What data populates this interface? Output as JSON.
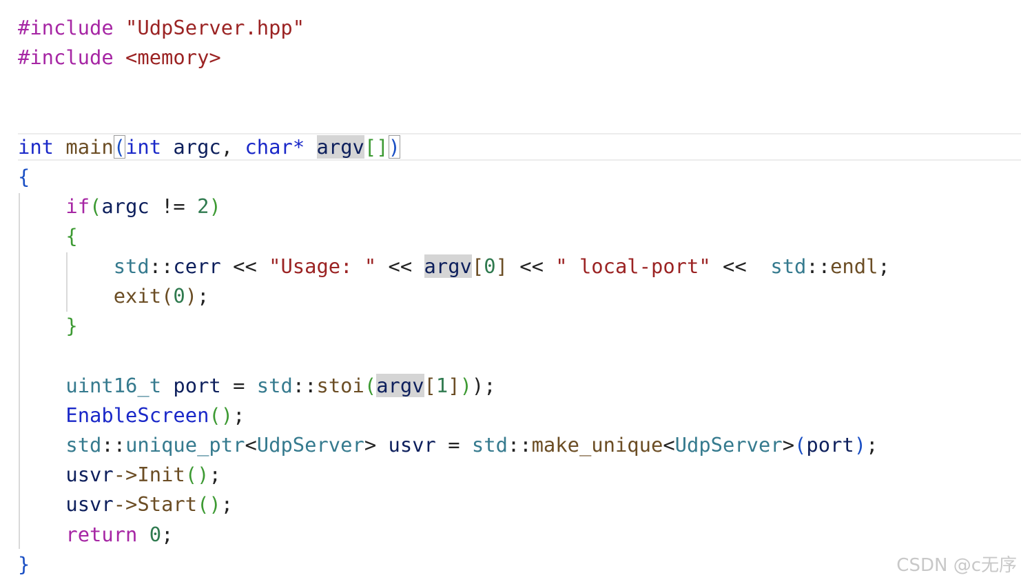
{
  "colors": {
    "directive": "#a626a4",
    "string": "#9b2323",
    "keyword": "#1a28c8",
    "type": "#357a8e",
    "function": "#6b4d24",
    "variable": "#0d1f5c",
    "number": "#2f7a4f",
    "plain": "#222222",
    "bracket_green": "#3d9a33",
    "bracket_blue": "#1a4fc4",
    "highlight_bg": "#d5d5d5",
    "match_border": "#9a9a9a",
    "watermark": "#c8c8c8"
  },
  "code": {
    "lines": [
      {
        "n": 1,
        "tokens": [
          {
            "t": "#include",
            "c": "directive"
          },
          {
            "t": " ",
            "c": "plain"
          },
          {
            "t": "\"UdpServer.hpp\"",
            "c": "string"
          }
        ]
      },
      {
        "n": 2,
        "tokens": [
          {
            "t": "#include",
            "c": "directive"
          },
          {
            "t": " ",
            "c": "plain"
          },
          {
            "t": "<memory>",
            "c": "string"
          }
        ]
      },
      {
        "n": 3,
        "tokens": []
      },
      {
        "n": 4,
        "tokens": []
      },
      {
        "n": 5,
        "tokens": [
          {
            "t": "int",
            "c": "keyword"
          },
          {
            "t": " ",
            "c": "plain"
          },
          {
            "t": "main",
            "c": "function"
          },
          {
            "t": "(",
            "c": "bracket_blue",
            "box": true
          },
          {
            "t": "int",
            "c": "keyword"
          },
          {
            "t": " ",
            "c": "plain"
          },
          {
            "t": "argc",
            "c": "variable"
          },
          {
            "t": ", ",
            "c": "plain"
          },
          {
            "t": "char",
            "c": "keyword"
          },
          {
            "t": "* ",
            "c": "keyword"
          },
          {
            "t": "argv",
            "c": "variable",
            "hl": true
          },
          {
            "t": "[]",
            "c": "bracket_green"
          },
          {
            "t": ")",
            "c": "bracket_blue",
            "box": true
          }
        ]
      },
      {
        "n": 6,
        "tokens": [
          {
            "t": "{",
            "c": "bracket_blue"
          }
        ]
      },
      {
        "n": 7,
        "tokens": [
          {
            "t": "    ",
            "c": "plain"
          },
          {
            "t": "if",
            "c": "directive"
          },
          {
            "t": "(",
            "c": "bracket_green"
          },
          {
            "t": "argc",
            "c": "variable"
          },
          {
            "t": " != ",
            "c": "plain"
          },
          {
            "t": "2",
            "c": "number"
          },
          {
            "t": ")",
            "c": "bracket_green"
          }
        ]
      },
      {
        "n": 8,
        "tokens": [
          {
            "t": "    ",
            "c": "plain"
          },
          {
            "t": "{",
            "c": "bracket_green"
          }
        ]
      },
      {
        "n": 9,
        "tokens": [
          {
            "t": "        ",
            "c": "plain"
          },
          {
            "t": "std",
            "c": "type"
          },
          {
            "t": "::",
            "c": "plain"
          },
          {
            "t": "cerr",
            "c": "variable"
          },
          {
            "t": " << ",
            "c": "plain"
          },
          {
            "t": "\"Usage: \"",
            "c": "string"
          },
          {
            "t": " << ",
            "c": "plain"
          },
          {
            "t": "argv",
            "c": "variable",
            "hl": true
          },
          {
            "t": "[",
            "c": "function"
          },
          {
            "t": "0",
            "c": "number"
          },
          {
            "t": "]",
            "c": "function"
          },
          {
            "t": " << ",
            "c": "plain"
          },
          {
            "t": "\" local-port\"",
            "c": "string"
          },
          {
            "t": " <<  ",
            "c": "plain"
          },
          {
            "t": "std",
            "c": "type"
          },
          {
            "t": "::",
            "c": "plain"
          },
          {
            "t": "endl",
            "c": "function"
          },
          {
            "t": ";",
            "c": "plain"
          }
        ]
      },
      {
        "n": 10,
        "tokens": [
          {
            "t": "        ",
            "c": "plain"
          },
          {
            "t": "exit",
            "c": "function"
          },
          {
            "t": "(",
            "c": "function"
          },
          {
            "t": "0",
            "c": "number"
          },
          {
            "t": ")",
            "c": "function"
          },
          {
            "t": ";",
            "c": "plain"
          }
        ]
      },
      {
        "n": 11,
        "tokens": [
          {
            "t": "    ",
            "c": "plain"
          },
          {
            "t": "}",
            "c": "bracket_green"
          }
        ]
      },
      {
        "n": 12,
        "tokens": []
      },
      {
        "n": 13,
        "tokens": [
          {
            "t": "    ",
            "c": "plain"
          },
          {
            "t": "uint16_t",
            "c": "type"
          },
          {
            "t": " ",
            "c": "plain"
          },
          {
            "t": "port",
            "c": "variable"
          },
          {
            "t": " = ",
            "c": "plain"
          },
          {
            "t": "std",
            "c": "type"
          },
          {
            "t": "::",
            "c": "plain"
          },
          {
            "t": "stoi",
            "c": "function"
          },
          {
            "t": "(",
            "c": "bracket_green"
          },
          {
            "t": "argv",
            "c": "variable",
            "hl": true
          },
          {
            "t": "[",
            "c": "function"
          },
          {
            "t": "1",
            "c": "number"
          },
          {
            "t": "]",
            "c": "function"
          },
          {
            "t": ")",
            "c": "bracket_green"
          },
          {
            "t": ");",
            "c": "plain"
          }
        ]
      },
      {
        "n": 14,
        "tokens": [
          {
            "t": "    ",
            "c": "plain"
          },
          {
            "t": "EnableScreen",
            "c": "keyword"
          },
          {
            "t": "()",
            "c": "bracket_green"
          },
          {
            "t": ";",
            "c": "plain"
          }
        ]
      },
      {
        "n": 15,
        "tokens": [
          {
            "t": "    ",
            "c": "plain"
          },
          {
            "t": "std",
            "c": "type"
          },
          {
            "t": "::",
            "c": "plain"
          },
          {
            "t": "unique_ptr",
            "c": "type"
          },
          {
            "t": "<",
            "c": "plain"
          },
          {
            "t": "UdpServer",
            "c": "type"
          },
          {
            "t": "> ",
            "c": "plain"
          },
          {
            "t": "usvr",
            "c": "variable"
          },
          {
            "t": " = ",
            "c": "plain"
          },
          {
            "t": "std",
            "c": "type"
          },
          {
            "t": "::",
            "c": "plain"
          },
          {
            "t": "make_unique",
            "c": "function"
          },
          {
            "t": "<",
            "c": "plain"
          },
          {
            "t": "UdpServer",
            "c": "type"
          },
          {
            "t": ">",
            "c": "plain"
          },
          {
            "t": "(",
            "c": "bracket_blue"
          },
          {
            "t": "port",
            "c": "variable"
          },
          {
            "t": ")",
            "c": "bracket_blue"
          },
          {
            "t": ";",
            "c": "plain"
          }
        ]
      },
      {
        "n": 16,
        "tokens": [
          {
            "t": "    ",
            "c": "plain"
          },
          {
            "t": "usvr",
            "c": "variable"
          },
          {
            "t": "->",
            "c": "function"
          },
          {
            "t": "Init",
            "c": "function"
          },
          {
            "t": "()",
            "c": "bracket_green"
          },
          {
            "t": ";",
            "c": "plain"
          }
        ]
      },
      {
        "n": 17,
        "tokens": [
          {
            "t": "    ",
            "c": "plain"
          },
          {
            "t": "usvr",
            "c": "variable"
          },
          {
            "t": "->",
            "c": "function"
          },
          {
            "t": "Start",
            "c": "function"
          },
          {
            "t": "()",
            "c": "bracket_green"
          },
          {
            "t": ";",
            "c": "plain"
          }
        ]
      },
      {
        "n": 18,
        "tokens": [
          {
            "t": "    ",
            "c": "plain"
          },
          {
            "t": "return",
            "c": "directive"
          },
          {
            "t": " ",
            "c": "plain"
          },
          {
            "t": "0",
            "c": "number"
          },
          {
            "t": ";",
            "c": "plain"
          }
        ]
      },
      {
        "n": 19,
        "tokens": [
          {
            "t": "}",
            "c": "bracket_blue"
          }
        ]
      }
    ]
  },
  "watermark": {
    "text": "CSDN @c无序"
  }
}
